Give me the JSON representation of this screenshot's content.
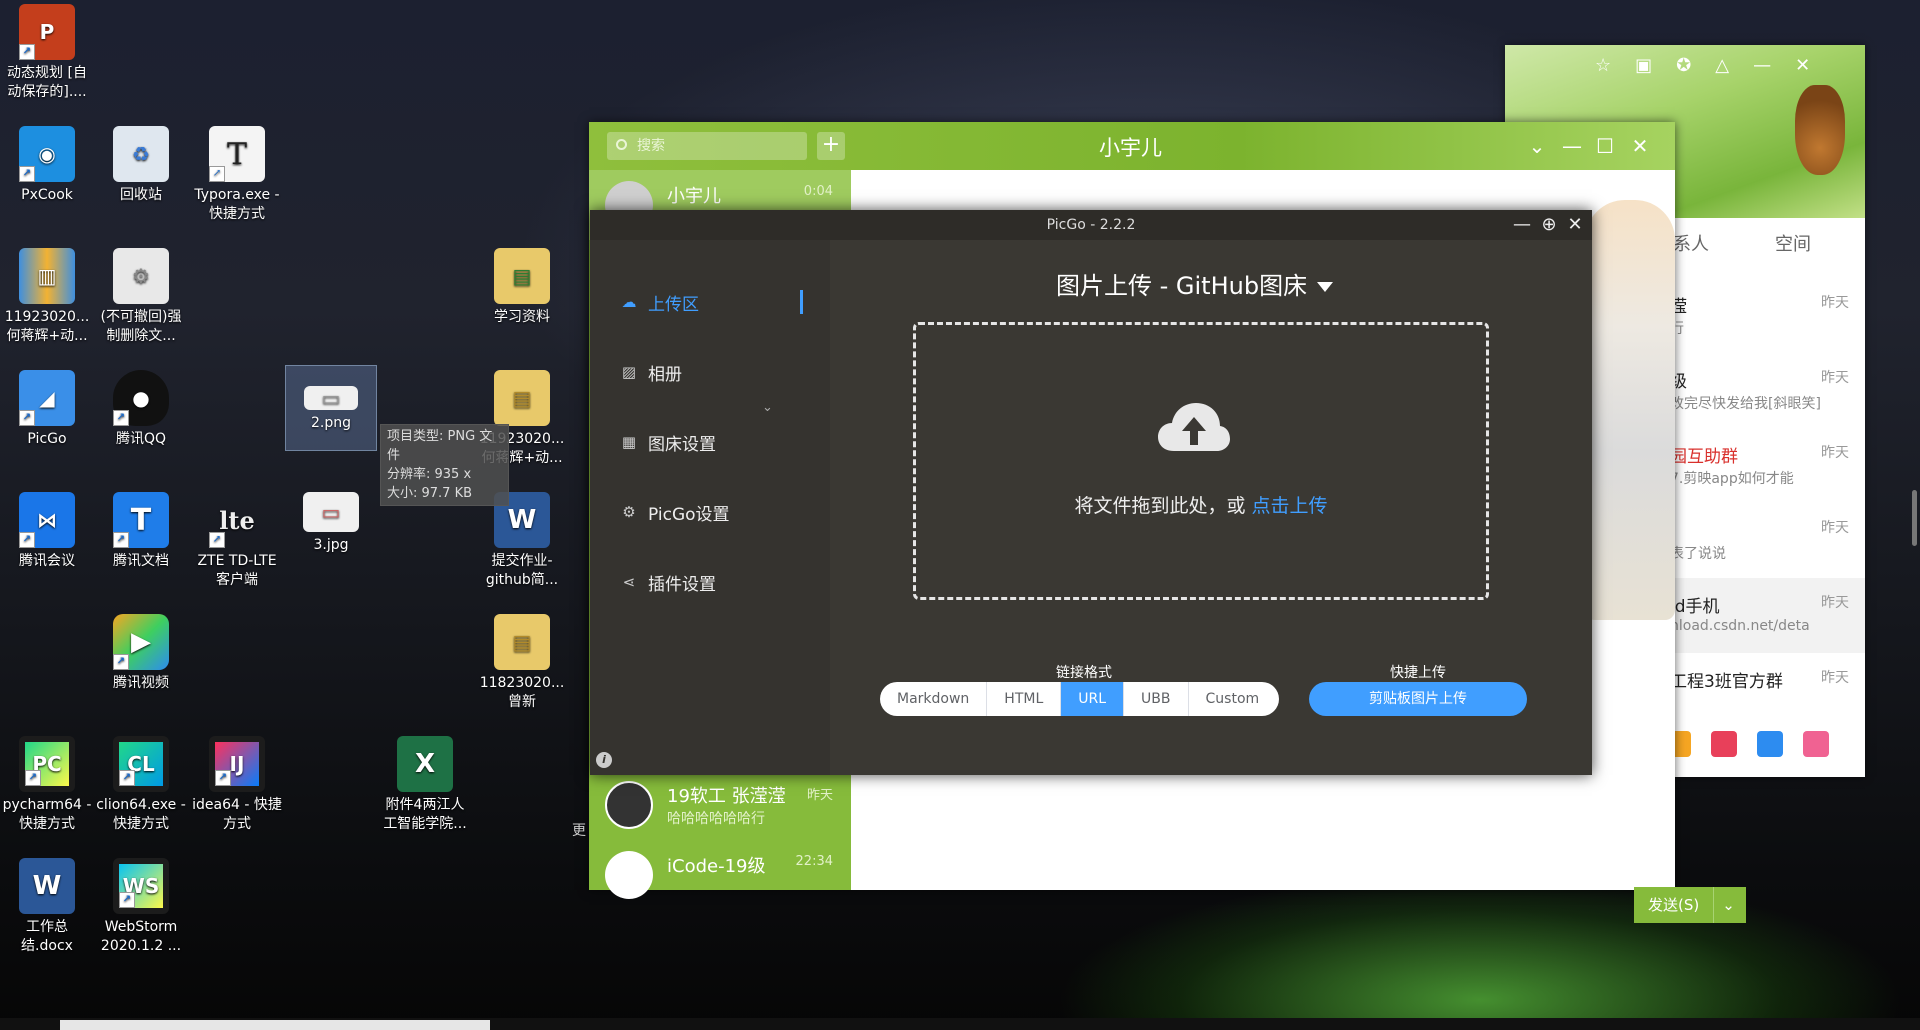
{
  "desktop_icons": [
    {
      "id": "ppt",
      "label": "动态规划 [自动保存的]....",
      "glyph": "P",
      "color": "#c43e1c"
    },
    {
      "id": "pxcook",
      "label": "PxCook",
      "glyph": "🍳",
      "color": "#1d8fe0"
    },
    {
      "id": "recycle",
      "label": "回收站",
      "glyph": "♻",
      "color": "#dfe7ef"
    },
    {
      "id": "typora",
      "label": "Typora.exe - 快捷方式",
      "glyph": "T",
      "color": "#f4f4f4"
    },
    {
      "id": "winrar",
      "label": "11923020... 何蒋辉+动...",
      "glyph": "▥",
      "color": "#3f8fde"
    },
    {
      "id": "forcedel",
      "label": "(不可撤回)强制删除文...",
      "glyph": "⚙",
      "color": "#e8e8e8"
    },
    {
      "id": "study",
      "label": "学习资料",
      "glyph": "▤",
      "color": "#e8c96a"
    },
    {
      "id": "picgo",
      "label": "PicGo",
      "glyph": "◢",
      "color": "#3a8fe8"
    },
    {
      "id": "qq",
      "label": "腾讯QQ",
      "glyph": "🐧",
      "color": "transparent"
    },
    {
      "id": "png2",
      "label": "2.png",
      "glyph": "▭",
      "color": "#f0f0f0"
    },
    {
      "id": "folder2",
      "label": "11923020... 何蒋辉+动...",
      "glyph": "▤",
      "color": "#e8c96a"
    },
    {
      "id": "tmeeting",
      "label": "腾讯会议",
      "glyph": "⋈",
      "color": "#1a76e8"
    },
    {
      "id": "tdoc",
      "label": "腾讯文档",
      "glyph": "T",
      "color": "#1f7de9"
    },
    {
      "id": "zte",
      "label": "ZTE TD-LTE 客户端",
      "glyph": "lte",
      "color": "transparent"
    },
    {
      "id": "jpg3",
      "label": "3.jpg",
      "glyph": "▭",
      "color": "#f0f0f0"
    },
    {
      "id": "word1",
      "label": "提交作业-github简...",
      "glyph": "W",
      "color": "#2b5797"
    },
    {
      "id": "tvideo",
      "label": "腾讯视频",
      "glyph": "▶",
      "color": "transparent"
    },
    {
      "id": "folder3",
      "label": "11823020... 曾新",
      "glyph": "▤",
      "color": "#e8c96a"
    },
    {
      "id": "pycharm",
      "label": "pycharm64 - 快捷方式",
      "glyph": "PC",
      "color": "#1c1c1c"
    },
    {
      "id": "clion",
      "label": "clion64.exe - 快捷方式",
      "glyph": "CL",
      "color": "#1c1c1c"
    },
    {
      "id": "idea",
      "label": "idea64 - 快捷方式",
      "glyph": "IJ",
      "color": "#1c1c1c"
    },
    {
      "id": "excel",
      "label": "附件4两江人工智能学院...",
      "glyph": "X",
      "color": "#1e7145"
    },
    {
      "id": "word2",
      "label": "工作总结.docx",
      "glyph": "W",
      "color": "#2b5797"
    },
    {
      "id": "webstorm",
      "label": "WebStorm 2020.1.2 ...",
      "glyph": "WS",
      "color": "#1c1c1c"
    }
  ],
  "tooltip": {
    "type": "项目类型: PNG 文件",
    "resolution": "分辨率: 935 x",
    "size": "大小: 97.7 KB"
  },
  "qq_chat": {
    "search_placeholder": "搜索",
    "title": "小宇儿",
    "conversations": [
      {
        "name": "小宇儿",
        "sub": "",
        "time": "0:04"
      },
      {
        "name": "19软工 张滢滢",
        "sub": "哈哈哈哈哈哈行",
        "time": "昨天"
      },
      {
        "name": "iCode-19级",
        "sub": "",
        "time": "22:34"
      }
    ],
    "send_label": "发送(S)",
    "more_label": "更"
  },
  "qq_list": {
    "tabs": [
      "系人",
      "空间"
    ],
    "items": [
      {
        "title": "滢",
        "sub": "行",
        "date": "昨天"
      },
      {
        "title": "级",
        "sub": "改完尽快发给我[斜眼笑]",
        "date": "昨天"
      },
      {
        "title": "园互助群",
        "sub": "7.剪映app如何才能",
        "date": "昨天"
      },
      {
        "title": "",
        "sub": "表了说说",
        "date": "昨天"
      },
      {
        "title": "id手机",
        "sub": "nload.csdn.net/deta",
        "date": "昨天"
      },
      {
        "title": "工程3班官方群",
        "sub": "",
        "date": "昨天"
      }
    ]
  },
  "picgo": {
    "window_title": "PicGo - 2.2.2",
    "menu": [
      {
        "label": "上传区",
        "icon": "cloud-upload-icon",
        "active": true
      },
      {
        "label": "相册",
        "icon": "image-icon",
        "active": false
      },
      {
        "label": "图床设置",
        "icon": "grid-icon",
        "active": false
      },
      {
        "label": "PicGo设置",
        "icon": "gear-icon",
        "active": false
      },
      {
        "label": "插件设置",
        "icon": "share-icon",
        "active": false
      }
    ],
    "heading": "图片上传 - GitHub图床",
    "drop_text": "将文件拖到此处，或",
    "drop_link": "点击上传",
    "link_format_label": "链接格式",
    "formats": [
      "Markdown",
      "HTML",
      "URL",
      "UBB",
      "Custom"
    ],
    "active_format": "URL",
    "quick_upload_label": "快捷上传",
    "clipboard_button": "剪贴板图片上传"
  },
  "colors": {
    "accent": "#409eff",
    "qq_green": "#86bb3b",
    "picgo_bg": "#3a3833"
  }
}
